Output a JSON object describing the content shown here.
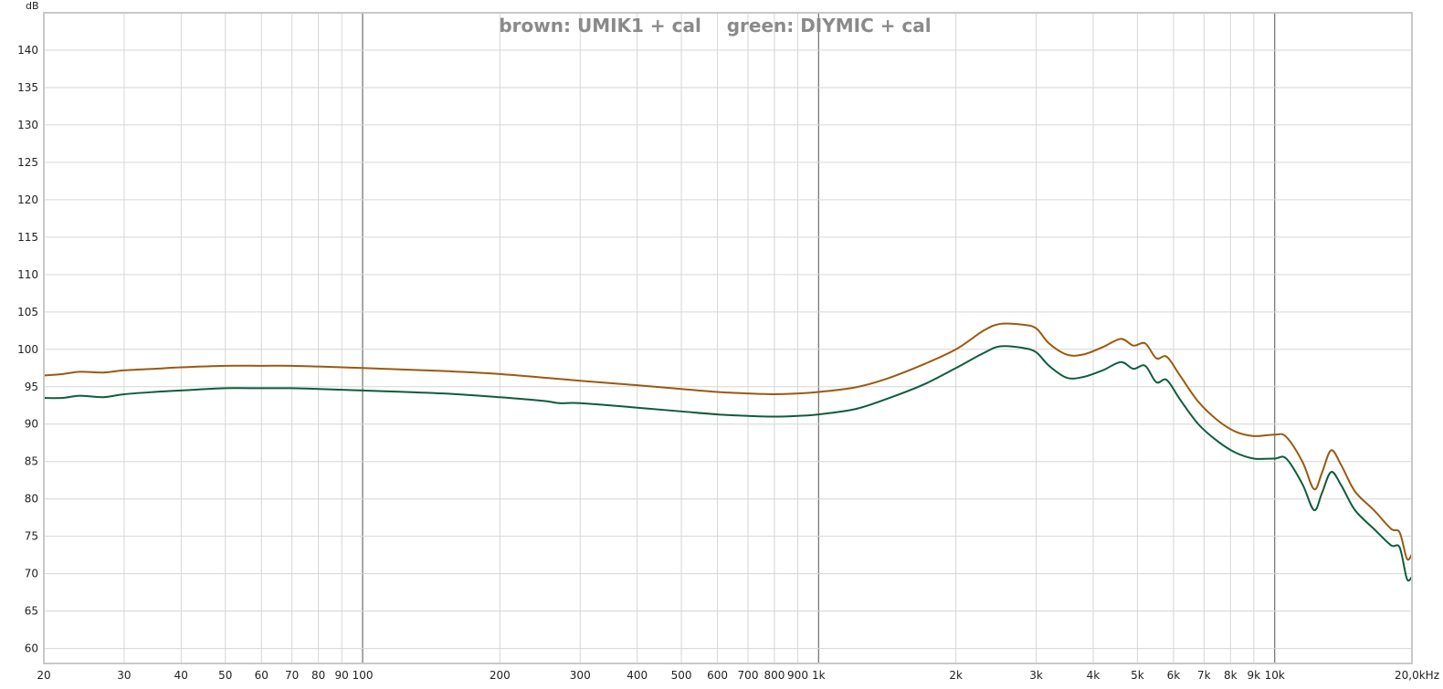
{
  "chart_data": {
    "type": "line",
    "title": "brown: UMIK1 + cal    green: DIYMIC + cal",
    "ylabel": "dB",
    "x_scale": "log",
    "xlim": [
      20,
      20000
    ],
    "ylim": [
      58,
      145
    ],
    "grid": true,
    "x_ticks": [
      {
        "value": 20,
        "label": "20"
      },
      {
        "value": 30,
        "label": "30"
      },
      {
        "value": 40,
        "label": "40"
      },
      {
        "value": 50,
        "label": "50"
      },
      {
        "value": 60,
        "label": "60"
      },
      {
        "value": 70,
        "label": "70"
      },
      {
        "value": 80,
        "label": "80"
      },
      {
        "value": 90,
        "label": "90"
      },
      {
        "value": 100,
        "label": "100"
      },
      {
        "value": 200,
        "label": "200"
      },
      {
        "value": 300,
        "label": "300"
      },
      {
        "value": 400,
        "label": "400"
      },
      {
        "value": 500,
        "label": "500"
      },
      {
        "value": 600,
        "label": "600"
      },
      {
        "value": 700,
        "label": "700"
      },
      {
        "value": 800,
        "label": "800"
      },
      {
        "value": 900,
        "label": "900"
      },
      {
        "value": 1000,
        "label": "1k"
      },
      {
        "value": 2000,
        "label": "2k"
      },
      {
        "value": 3000,
        "label": "3k"
      },
      {
        "value": 4000,
        "label": "4k"
      },
      {
        "value": 5000,
        "label": "5k"
      },
      {
        "value": 6000,
        "label": "6k"
      },
      {
        "value": 7000,
        "label": "7k"
      },
      {
        "value": 8000,
        "label": "8k"
      },
      {
        "value": 9000,
        "label": "9k"
      },
      {
        "value": 10000,
        "label": "10k"
      },
      {
        "value": 20000,
        "label": "20,0kHz"
      }
    ],
    "major_x": [
      100,
      1000,
      10000
    ],
    "y_ticks": [
      60,
      65,
      70,
      75,
      80,
      85,
      90,
      95,
      100,
      105,
      110,
      115,
      120,
      125,
      130,
      135,
      140
    ],
    "series": [
      {
        "name": "UMIK1 + cal",
        "color": "#9a5a10",
        "points": [
          [
            20,
            96.5
          ],
          [
            22,
            96.7
          ],
          [
            24,
            97.0
          ],
          [
            27,
            96.9
          ],
          [
            30,
            97.2
          ],
          [
            35,
            97.4
          ],
          [
            40,
            97.6
          ],
          [
            50,
            97.8
          ],
          [
            60,
            97.8
          ],
          [
            70,
            97.8
          ],
          [
            80,
            97.7
          ],
          [
            100,
            97.5
          ],
          [
            150,
            97.1
          ],
          [
            200,
            96.7
          ],
          [
            300,
            95.8
          ],
          [
            400,
            95.2
          ],
          [
            500,
            94.7
          ],
          [
            600,
            94.3
          ],
          [
            700,
            94.1
          ],
          [
            800,
            94.0
          ],
          [
            900,
            94.1
          ],
          [
            1000,
            94.3
          ],
          [
            1200,
            94.9
          ],
          [
            1400,
            96.0
          ],
          [
            1700,
            98.0
          ],
          [
            2000,
            100.0
          ],
          [
            2300,
            102.5
          ],
          [
            2500,
            103.4
          ],
          [
            2800,
            103.3
          ],
          [
            3000,
            102.8
          ],
          [
            3200,
            100.8
          ],
          [
            3500,
            99.3
          ],
          [
            3800,
            99.3
          ],
          [
            4200,
            100.3
          ],
          [
            4600,
            101.4
          ],
          [
            4900,
            100.5
          ],
          [
            5200,
            100.8
          ],
          [
            5500,
            98.8
          ],
          [
            5800,
            99.0
          ],
          [
            6200,
            96.5
          ],
          [
            6800,
            93.0
          ],
          [
            7500,
            90.5
          ],
          [
            8200,
            89.0
          ],
          [
            9000,
            88.4
          ],
          [
            10000,
            88.6
          ],
          [
            10600,
            88.3
          ],
          [
            11500,
            85.0
          ],
          [
            12200,
            81.3
          ],
          [
            12700,
            83.5
          ],
          [
            13300,
            86.5
          ],
          [
            14000,
            84.5
          ],
          [
            15000,
            81.0
          ],
          [
            16500,
            78.5
          ],
          [
            18000,
            76.0
          ],
          [
            18800,
            75.5
          ],
          [
            19500,
            72.0
          ],
          [
            20000,
            72.6
          ]
        ]
      },
      {
        "name": "DIYMIC + cal",
        "color": "#0f5c3c",
        "points": [
          [
            20,
            93.5
          ],
          [
            22,
            93.5
          ],
          [
            24,
            93.8
          ],
          [
            27,
            93.6
          ],
          [
            30,
            94.0
          ],
          [
            35,
            94.3
          ],
          [
            40,
            94.5
          ],
          [
            50,
            94.8
          ],
          [
            60,
            94.8
          ],
          [
            70,
            94.8
          ],
          [
            80,
            94.7
          ],
          [
            100,
            94.5
          ],
          [
            150,
            94.1
          ],
          [
            200,
            93.6
          ],
          [
            250,
            93.1
          ],
          [
            270,
            92.8
          ],
          [
            300,
            92.8
          ],
          [
            400,
            92.2
          ],
          [
            500,
            91.7
          ],
          [
            600,
            91.3
          ],
          [
            700,
            91.1
          ],
          [
            800,
            91.0
          ],
          [
            900,
            91.1
          ],
          [
            1000,
            91.3
          ],
          [
            1200,
            92.0
          ],
          [
            1400,
            93.3
          ],
          [
            1700,
            95.3
          ],
          [
            2000,
            97.5
          ],
          [
            2300,
            99.5
          ],
          [
            2500,
            100.4
          ],
          [
            2800,
            100.2
          ],
          [
            3000,
            99.6
          ],
          [
            3200,
            97.8
          ],
          [
            3500,
            96.2
          ],
          [
            3800,
            96.3
          ],
          [
            4200,
            97.2
          ],
          [
            4600,
            98.3
          ],
          [
            4900,
            97.4
          ],
          [
            5200,
            97.8
          ],
          [
            5500,
            95.6
          ],
          [
            5800,
            95.9
          ],
          [
            6200,
            93.3
          ],
          [
            6800,
            90.0
          ],
          [
            7500,
            87.7
          ],
          [
            8200,
            86.2
          ],
          [
            9000,
            85.4
          ],
          [
            10000,
            85.4
          ],
          [
            10600,
            85.4
          ],
          [
            11500,
            82.0
          ],
          [
            12200,
            78.5
          ],
          [
            12700,
            80.8
          ],
          [
            13300,
            83.6
          ],
          [
            14000,
            81.8
          ],
          [
            15000,
            78.5
          ],
          [
            16500,
            76.0
          ],
          [
            18000,
            73.8
          ],
          [
            18800,
            73.5
          ],
          [
            19500,
            69.3
          ],
          [
            20000,
            69.6
          ]
        ]
      }
    ]
  }
}
